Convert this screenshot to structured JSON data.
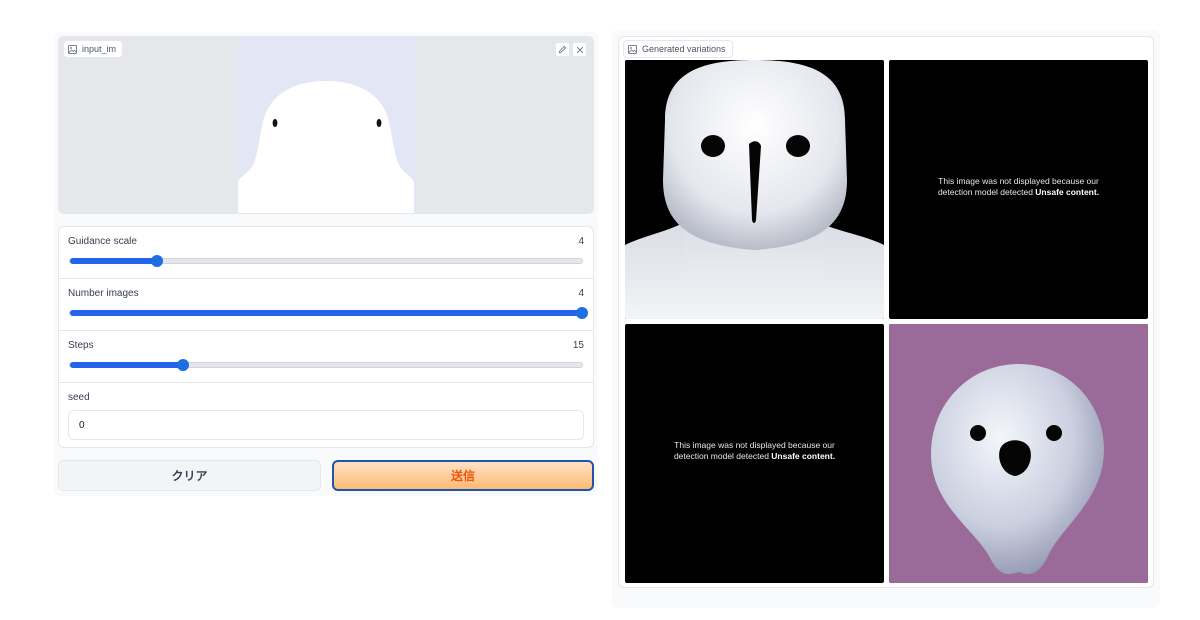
{
  "input_panel": {
    "label": "input_im",
    "label_icon": "image-icon",
    "edit_icon": "pencil-icon",
    "close_icon": "close-icon"
  },
  "sliders": [
    {
      "label": "Guidance scale",
      "value": "4",
      "fraction": 0.169
    },
    {
      "label": "Number images",
      "value": "4",
      "fraction": 1.0
    },
    {
      "label": "Steps",
      "value": "15",
      "fraction": 0.22
    }
  ],
  "seed": {
    "label": "seed",
    "value": "0"
  },
  "buttons": {
    "clear_label": "クリア",
    "submit_label": "送信"
  },
  "gallery": {
    "label": "Generated variations",
    "label_icon": "image-icon",
    "nsfw_line1": "This image was not displayed because our",
    "nsfw_line2_prefix": "detection model detected",
    "nsfw_line2_strong": "Unsafe content."
  },
  "colors": {
    "accent": "#1d6fe3",
    "submit_bg": "#fdba74",
    "submit_text": "#ea580c",
    "submit_border": "#1e55a8"
  }
}
